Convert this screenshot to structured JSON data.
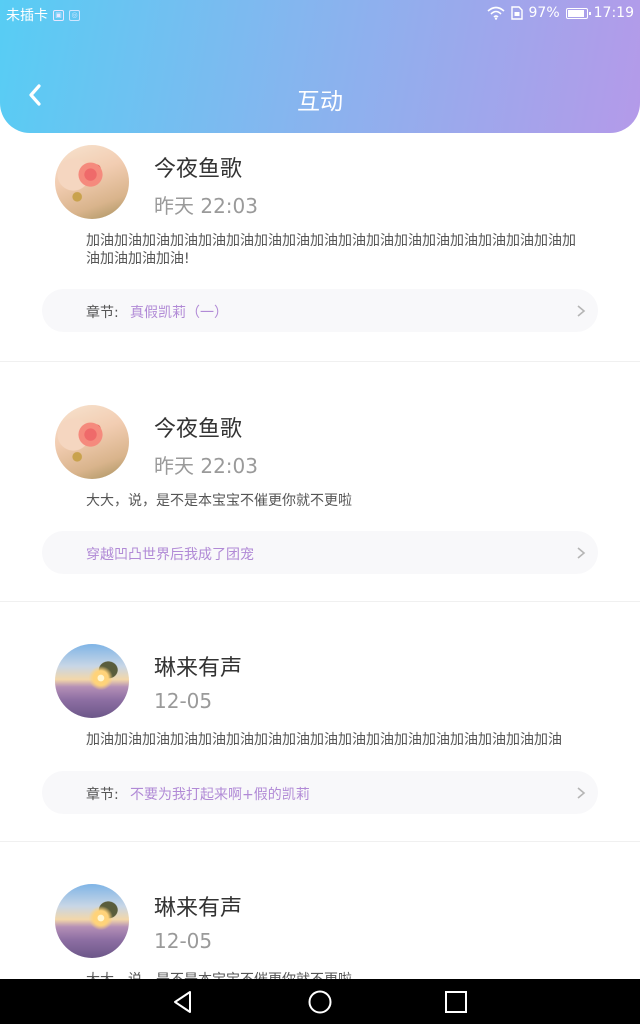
{
  "status_bar": {
    "carrier": "未插卡",
    "battery": "97%",
    "time": "17:19"
  },
  "header": {
    "title": "互动"
  },
  "chapter_label": "章节:",
  "items": [
    {
      "name": "今夜鱼歌",
      "time": "昨天 22:03",
      "message": "加油加油加油加油加油加油加油加油加油加油加油加油加油加油加油加油加油加油加油加油加油!",
      "chapter_prefix": "章节:",
      "chapter": "真假凯莉（一）",
      "avatar": "flower"
    },
    {
      "name": "今夜鱼歌",
      "time": "昨天 22:03",
      "message": "大大，说，是不是本宝宝不催更你就不更啦",
      "chapter_prefix": "",
      "chapter": "穿越凹凸世界后我成了团宠",
      "avatar": "flower"
    },
    {
      "name": "琳来有声",
      "time": "12-05",
      "message": "加油加油加油加油加油加油加油加油加油加油加油加油加油加油加油加油加油",
      "chapter_prefix": "章节:",
      "chapter": "不要为我打起来啊+假的凯莉",
      "avatar": "sunset"
    },
    {
      "name": "琳来有声",
      "time": "12-05",
      "message": "大大，说，是不是本宝宝不催更你就不更啦",
      "chapter_prefix": "",
      "chapter": "",
      "avatar": "sunset"
    }
  ],
  "icons": {
    "back": "chevron-left-icon",
    "chapter_arrow": "chevron-right-icon",
    "nav_back": "triangle-back-icon",
    "nav_home": "circle-home-icon",
    "nav_recent": "square-recent-icon"
  },
  "colors": {
    "header_gradient_start": "#57cdf4",
    "header_gradient_end": "#b49ae9",
    "chapter_text": "#b18ad6"
  }
}
